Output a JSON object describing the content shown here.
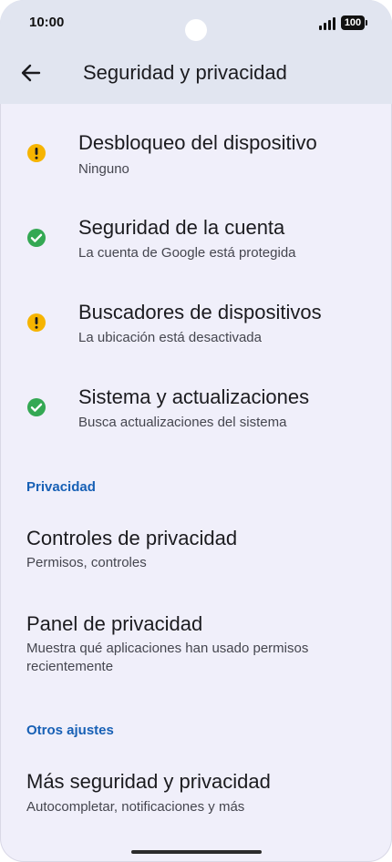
{
  "status": {
    "time": "10:00",
    "battery": "100"
  },
  "header": {
    "title": "Seguridad y privacidad"
  },
  "security_items": [
    {
      "title": "Desbloqueo del dispositivo",
      "subtitle": "Ninguno",
      "status": "warning"
    },
    {
      "title": "Seguridad de la cuenta",
      "subtitle": "La cuenta de Google está protegida",
      "status": "ok"
    },
    {
      "title": "Buscadores de dispositivos",
      "subtitle": "La ubicación está desactivada",
      "status": "warning"
    },
    {
      "title": "Sistema y actualizaciones",
      "subtitle": "Busca actualizaciones del sistema",
      "status": "ok"
    }
  ],
  "privacy_section": {
    "header": "Privacidad",
    "items": [
      {
        "title": "Controles de privacidad",
        "subtitle": "Permisos, controles"
      },
      {
        "title": "Panel de privacidad",
        "subtitle": "Muestra qué aplicaciones han usado permisos recientemente"
      }
    ]
  },
  "other_section": {
    "header": "Otros ajustes",
    "items": [
      {
        "title": "Más seguridad y privacidad",
        "subtitle": "Autocompletar, notificaciones y más"
      }
    ]
  },
  "colors": {
    "warning": "#f6b400",
    "ok": "#34a853",
    "accent": "#1760b5",
    "background": "#f0effa",
    "top_bar": "#e1e5f0"
  },
  "icons": {
    "warning": "warning-icon",
    "ok": "check-circle-icon",
    "back": "arrow-back-icon"
  }
}
